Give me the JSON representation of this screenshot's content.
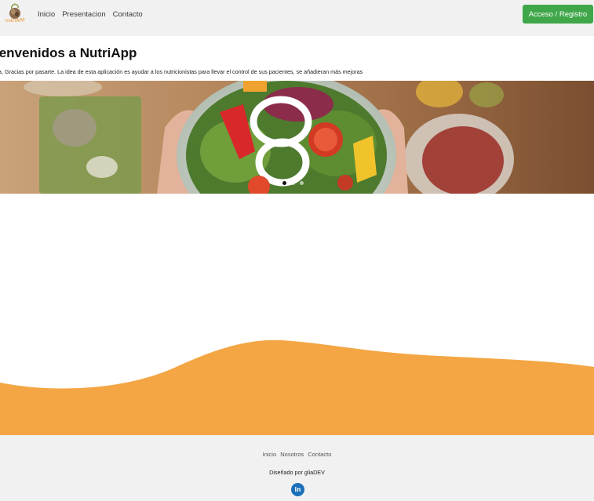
{
  "colors": {
    "accent_green": "#3fa74a",
    "wave_orange": "#f4a644",
    "navbar_bg": "#f1f1f1",
    "linkedin_blue": "#1c6fb8"
  },
  "header": {
    "logo_text": "nutriAPP",
    "logo_icon": "seed-logo-icon",
    "nav": [
      {
        "label": "Inicio"
      },
      {
        "label": "Presentacion"
      },
      {
        "label": "Contacto"
      }
    ],
    "access_button": "Acceso / Registro"
  },
  "hero": {
    "title": "ienvenidos a NutriApp",
    "subtitle": "a, Gracias por pasarte. La idea de esta aplicación es ayudar a los nutricionistas para llevar el control de sus pacientes, se añadieran más mejoras",
    "banner_image": "salad-bowl-photo",
    "carousel": {
      "slides": 3,
      "active": 1
    }
  },
  "footer": {
    "links": [
      {
        "label": "Inicio"
      },
      {
        "label": "Nosotros"
      },
      {
        "label": "Contacto"
      }
    ],
    "credit": "Diseñado por gliaDEV",
    "social_icon": "linkedin-icon",
    "social_label": "in"
  }
}
